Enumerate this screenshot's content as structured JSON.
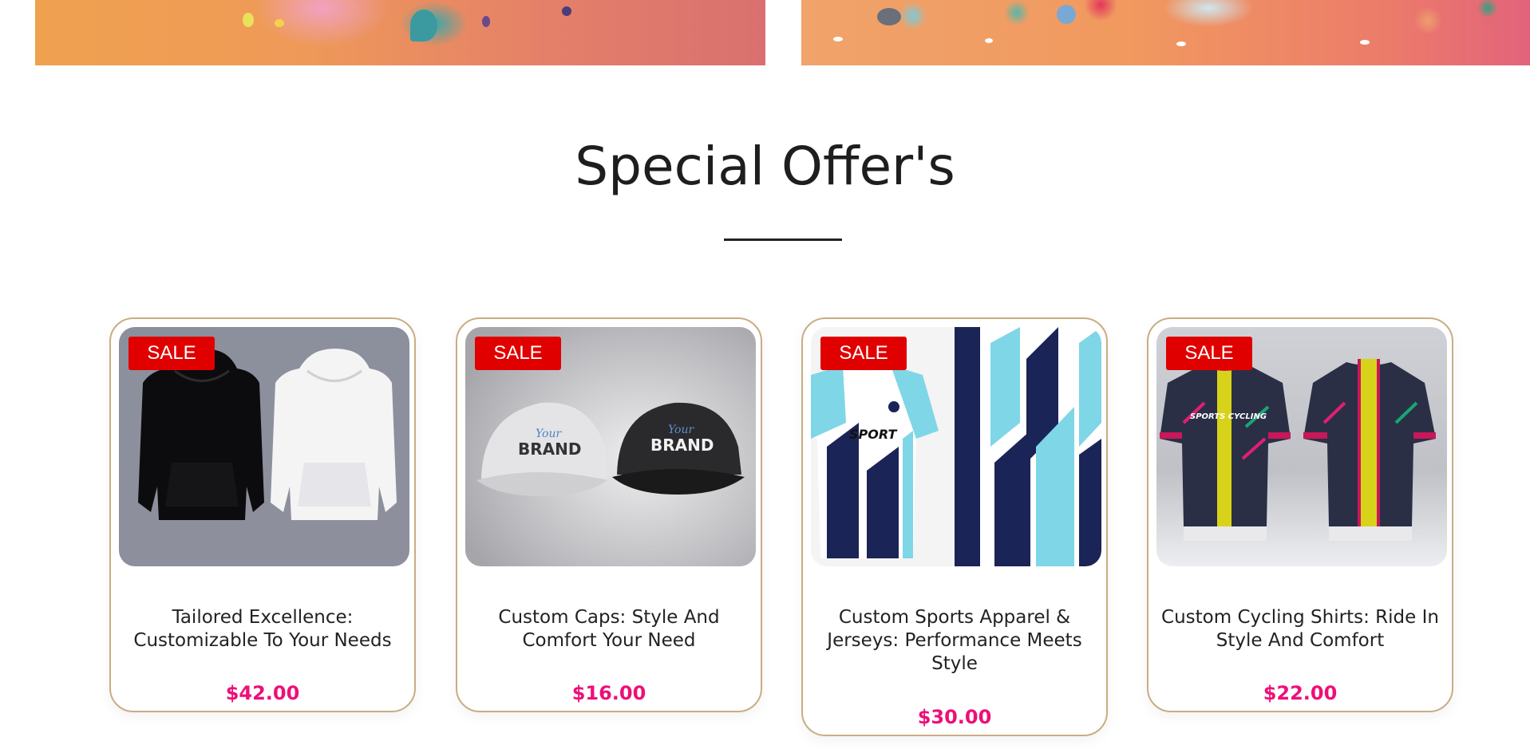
{
  "section": {
    "title": "Special Offer's"
  },
  "products": [
    {
      "badge": "SALE",
      "title": "Tailored Excellence: Customizable To Your Needs",
      "price": "$42.00",
      "image_icon": "hoodies-image"
    },
    {
      "badge": "SALE",
      "title": "Custom Caps: Style And Comfort Your Need",
      "price": "$16.00",
      "image_icon": "caps-image",
      "cap_text_script": "Your",
      "cap_text_brand": "BRAND"
    },
    {
      "badge": "SALE",
      "title": "Custom Sports Apparel & Jerseys: Performance Meets Style",
      "price": "$30.00",
      "image_icon": "jersey-image",
      "jersey_text": "SPORT"
    },
    {
      "badge": "SALE",
      "title": "Custom Cycling Shirts: Ride In Style And Comfort",
      "price": "$22.00",
      "image_icon": "cycling-shirts-image",
      "shirt_text": "SPORTS CYCLING"
    }
  ],
  "colors": {
    "sale_badge": "#e00000",
    "price": "#ee0f78",
    "card_border": "#c9ac84",
    "title_text": "#1e1e1e"
  }
}
